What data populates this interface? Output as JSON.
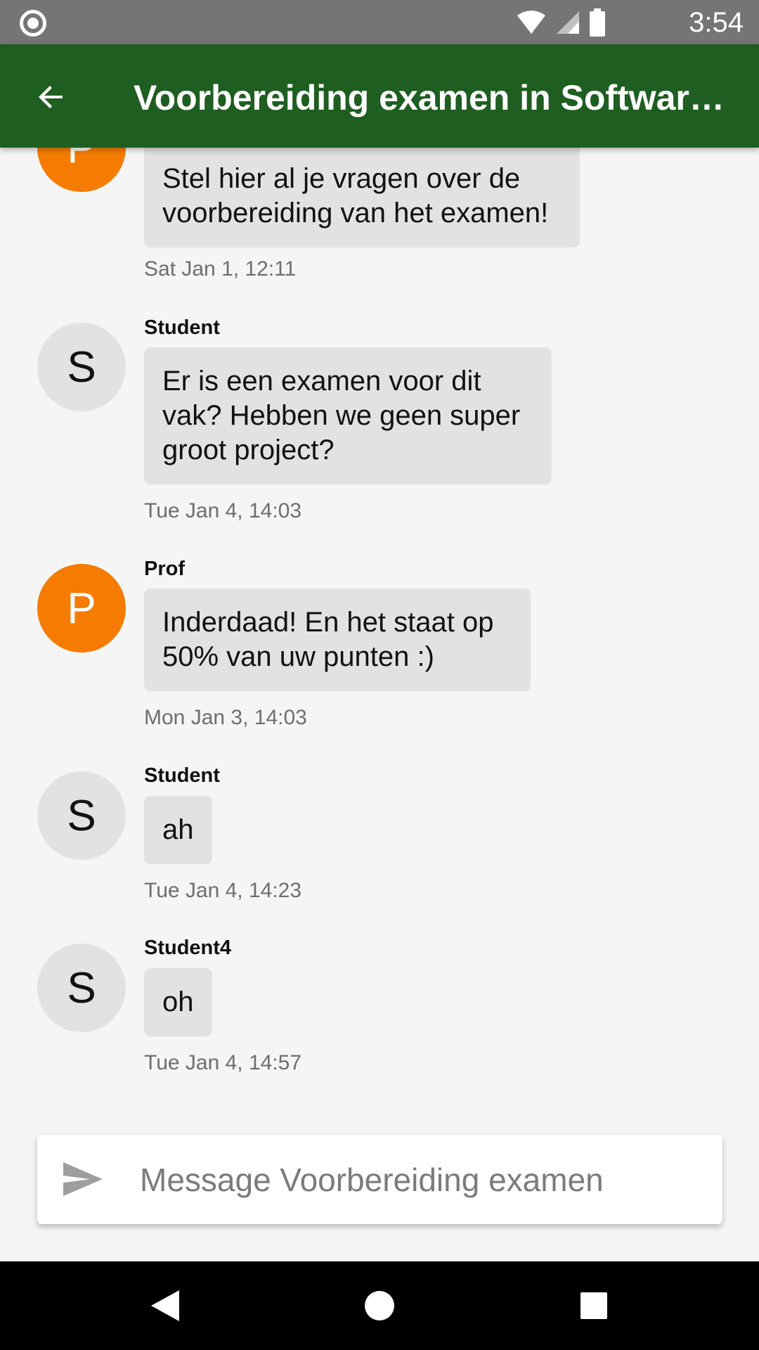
{
  "status_bar": {
    "time": "3:54",
    "icons": [
      "record-icon",
      "wifi-icon",
      "signal-icon",
      "battery-icon"
    ]
  },
  "app_bar": {
    "title": "Voorbereiding examen in Software...",
    "back_icon": "arrow-left-icon"
  },
  "messages": [
    {
      "sender": "",
      "avatar_letter": "P",
      "role": "prof",
      "text": "Stel hier al je vragen over de voorbereiding van het examen!",
      "timestamp": "Sat Jan 1, 12:11"
    },
    {
      "sender": "Student",
      "avatar_letter": "S",
      "role": "student",
      "text": "Er is een examen voor dit vak? Hebben we geen super groot project?",
      "timestamp": "Tue Jan 4, 14:03"
    },
    {
      "sender": "Prof",
      "avatar_letter": "P",
      "role": "prof",
      "text": "Inderdaad! En het staat op 50% van uw punten :)",
      "timestamp": "Mon Jan 3, 14:03"
    },
    {
      "sender": "Student",
      "avatar_letter": "S",
      "role": "student",
      "text": "ah",
      "timestamp": "Tue Jan 4, 14:23"
    },
    {
      "sender": "Student4",
      "avatar_letter": "S",
      "role": "student",
      "text": "oh",
      "timestamp": "Tue Jan 4, 14:57"
    }
  ],
  "composer": {
    "placeholder": "Message Voorbereiding examen",
    "value": "",
    "send_icon": "send-icon"
  },
  "nav_bar": {
    "icons": [
      "back-triangle-icon",
      "home-circle-icon",
      "recents-square-icon"
    ]
  },
  "colors": {
    "app_bar": "#1e5e20",
    "prof_avatar": "#f57c00",
    "student_avatar": "#e2e2e2",
    "bubble": "#e2e2e2",
    "status_bar": "#757575"
  }
}
